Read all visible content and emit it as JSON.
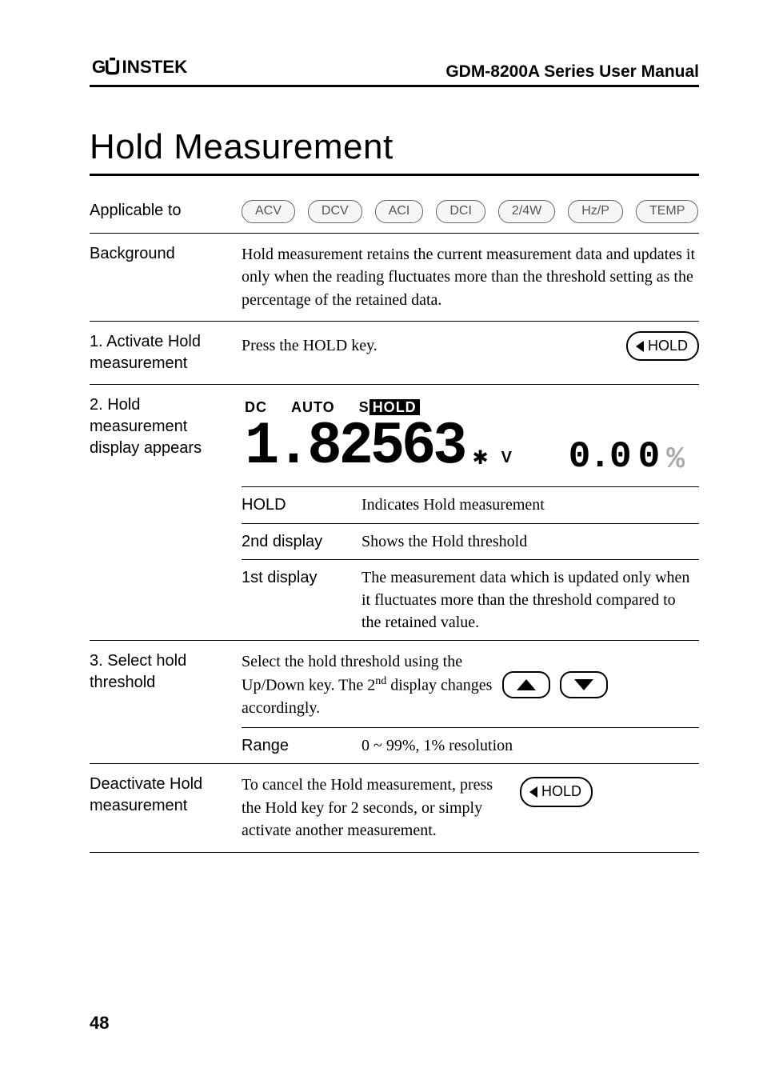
{
  "header": {
    "brand_text": "GWINSTEK",
    "manual_title": "GDM-8200A Series User Manual"
  },
  "section_title": "Hold Measurement",
  "rows": {
    "applicable": {
      "label": "Applicable to",
      "tags": [
        "ACV",
        "DCV",
        "ACI",
        "DCI",
        "2/4W",
        "Hz/P",
        "TEMP"
      ]
    },
    "background": {
      "label": "Background",
      "text": "Hold measurement retains the current measurement data and updates it only when the reading fluctuates more than the threshold setting as the percentage of the retained data."
    },
    "activate": {
      "label": "1. Activate Hold measurement",
      "text": "Press the HOLD key.",
      "key_label": "HOLD"
    },
    "display": {
      "label": "2. Hold measurement display appears",
      "lcd": {
        "indicator1": "DC",
        "indicator2": "AUTO",
        "indicator3_s": "S",
        "indicator3_hold": "HOLD",
        "main": "1.82563",
        "star": "✱",
        "unit": "V",
        "second_a": "0.0",
        "second_b": "0",
        "percent": "%"
      },
      "subrows": [
        {
          "label": "HOLD",
          "text": "Indicates Hold measurement"
        },
        {
          "label": "2nd display",
          "text": "Shows the Hold threshold"
        },
        {
          "label": "1st display",
          "text": "The measurement data which is updated only when it fluctuates more than the threshold compared to the retained value."
        }
      ]
    },
    "select": {
      "label": "3. Select hold threshold",
      "text_pre": "Select the hold threshold using the Up/Down key. The 2",
      "text_sup": "nd",
      "text_post": " display changes accordingly.",
      "range_label": "Range",
      "range_text": "0 ~ 99%, 1% resolution"
    },
    "deactivate": {
      "label": "Deactivate Hold measurement",
      "text": "To cancel the Hold measurement, press the Hold key for 2 seconds, or simply activate another measurement.",
      "key_label": "HOLD"
    }
  },
  "page_number": "48"
}
